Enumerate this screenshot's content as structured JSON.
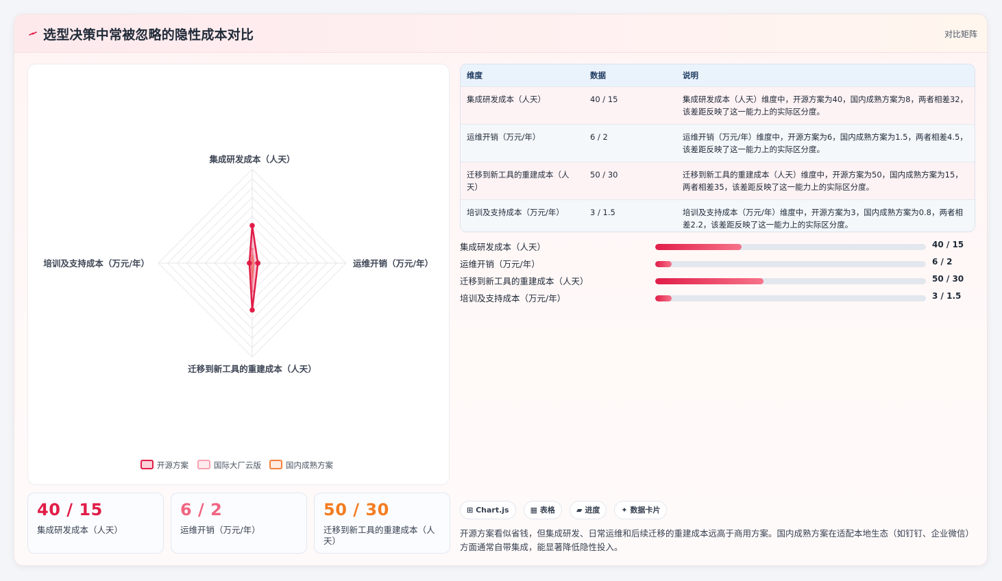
{
  "header": {
    "title": "选型决策中常被忽略的隐性成本对比",
    "right_label": "对比矩阵"
  },
  "colors": {
    "primary": "#e11d48",
    "secondary": "#f6a2b0",
    "tertiary": "#f47f3c",
    "kpi2": "#f06581",
    "kpi3": "#f47c20"
  },
  "chart_data": {
    "type": "radar",
    "axes": [
      "集成研发成本（人天）",
      "运维开销（万元/年）",
      "迁移到新工具的重建成本（人天）",
      "培训及支持成本（万元/年）"
    ],
    "rmax": 100,
    "series": [
      {
        "name": "开源方案",
        "values": [
          40,
          6,
          50,
          3
        ]
      },
      {
        "name": "国际大厂云版",
        "values": [
          15,
          2,
          30,
          1.5
        ]
      },
      {
        "name": "国内成熟方案",
        "values": [
          8,
          1.5,
          15,
          0.8
        ]
      }
    ],
    "legend_position": "bottom"
  },
  "table": {
    "headers": [
      "维度",
      "数据",
      "说明"
    ],
    "rows": [
      {
        "dim": "集成研发成本（人天）",
        "data": "40 / 15",
        "desc": "集成研发成本（人天）维度中，开源方案为40，国内成熟方案为8，两者相差32，该差距反映了这一能力上的实际区分度。"
      },
      {
        "dim": "运维开销（万元/年）",
        "data": "6 / 2",
        "desc": "运维开销（万元/年）维度中，开源方案为6，国内成熟方案为1.5，两者相差4.5，该差距反映了这一能力上的实际区分度。"
      },
      {
        "dim": "迁移到新工具的重建成本（人天）",
        "data": "50 / 30",
        "desc": "迁移到新工具的重建成本（人天）维度中，开源方案为50，国内成熟方案为15，两者相差35，该差距反映了这一能力上的实际区分度。"
      },
      {
        "dim": "培训及支持成本（万元/年）",
        "data": "3 / 1.5",
        "desc": "培训及支持成本（万元/年）维度中，开源方案为3，国内成熟方案为0.8，两者相差2.2，该差距反映了这一能力上的实际区分度。"
      }
    ]
  },
  "progress": [
    {
      "label": "集成研发成本（人天）",
      "value": "40 / 15",
      "fraction": 0.32
    },
    {
      "label": "运维开销（万元/年）",
      "value": "6 / 2",
      "fraction": 0.06
    },
    {
      "label": "迁移到新工具的重建成本（人天）",
      "value": "50 / 30",
      "fraction": 0.4
    },
    {
      "label": "培训及支持成本（万元/年）",
      "value": "3 / 1.5",
      "fraction": 0.06
    }
  ],
  "kpis": [
    {
      "value": "40 / 15",
      "label": "集成研发成本（人天）"
    },
    {
      "value": "6 / 2",
      "label": "运维开销（万元/年）"
    },
    {
      "value": "50 / 30",
      "label": "迁移到新工具的重建成本（人天）"
    }
  ],
  "tags": [
    {
      "icon": "⊞",
      "label": "Chart.js"
    },
    {
      "icon": "▦",
      "label": "表格"
    },
    {
      "icon": "▰",
      "label": "进度"
    },
    {
      "icon": "✦",
      "label": "数据卡片"
    }
  ],
  "summary": "开源方案看似省钱，但集成研发、日常运维和后续迁移的重建成本远高于商用方案。国内成熟方案在适配本地生态（如钉钉、企业微信）方面通常自带集成，能显著降低隐性投入。"
}
